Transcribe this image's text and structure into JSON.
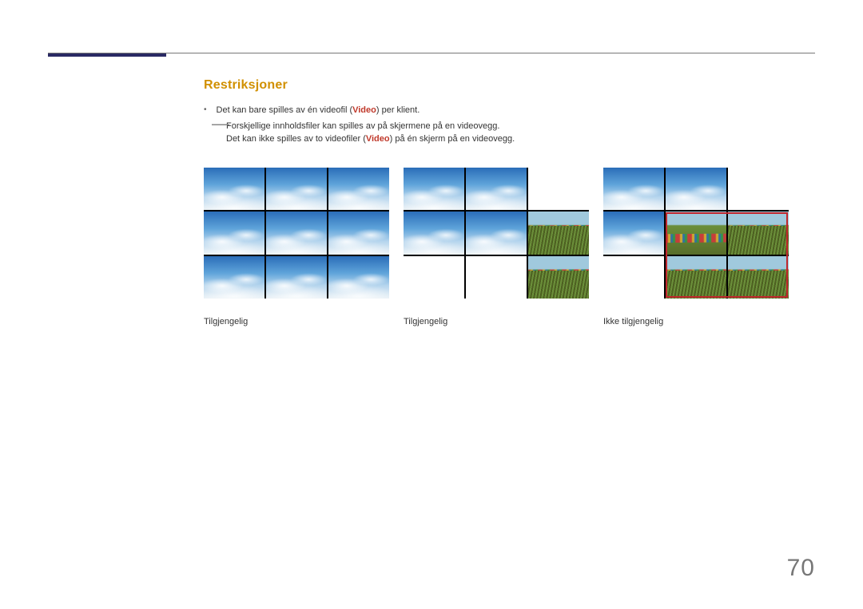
{
  "section_title": "Restriksjoner",
  "bullet_1_prefix": "Det kan bare spilles av én videofil (",
  "bullet_1_kw": "Video",
  "bullet_1_suffix": ") per klient.",
  "sub_1": "Forskjellige innholdsfiler kan spilles av på skjermene på en videovegg.",
  "sub_2_prefix": "Det kan ikke spilles av to videofiler (",
  "sub_2_kw": "Video",
  "sub_2_suffix": ") på én skjerm på en videovegg.",
  "captions": {
    "a": "Tilgjengelig",
    "b": "Tilgjengelig",
    "c": "Ikke tilgjengelig"
  },
  "page_number": "70"
}
